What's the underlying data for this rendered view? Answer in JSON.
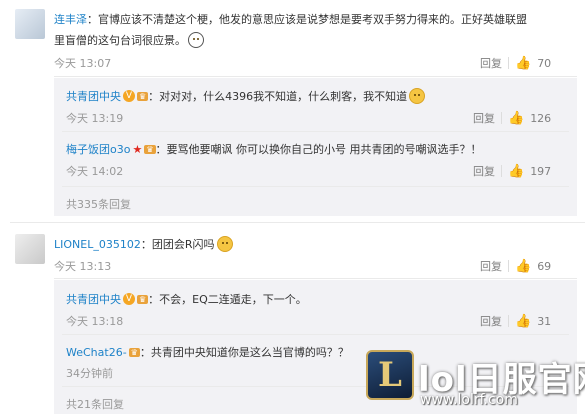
{
  "comments": [
    {
      "user": "连丰泽",
      "text_line1": "：官博应该不清楚这个梗，他发的意思应该是说梦想是要考双手努力得来的。正好英雄联盟",
      "text_line2": "里盲僧的这句台词很应景。",
      "emoji": "dog-emoji",
      "time": "今天 13:07",
      "reply_label": "回复",
      "likes": "70",
      "replies": [
        {
          "user": "共青团中央",
          "text": "：对对对，什么4396我不知道，什么刺客，我不知道",
          "emoji": "smile-emoji",
          "time": "今天 13:19",
          "reply_label": "回复",
          "likes": "126"
        },
        {
          "user": "梅子饭团o3o",
          "text": "：要骂他要嘲讽 你可以换你自己的小号 用共青团的号嘲讽选手？！",
          "time": "今天 14:02",
          "reply_label": "回复",
          "likes": "197"
        }
      ],
      "more_replies": "共335条回复"
    },
    {
      "user": "LIONEL_035102",
      "text": "：团团会R闪吗",
      "emoji": "smile-emoji",
      "time": "今天 13:13",
      "reply_label": "回复",
      "likes": "69",
      "replies": [
        {
          "user": "共青团中央",
          "text": "：不会，EQ二连遁走，下一个。",
          "time": "今天 13:18",
          "reply_label": "回复",
          "likes": "31"
        },
        {
          "user": "WeChat26-",
          "text": "：共青团中央知道你是这么当官博的吗？？",
          "time": "34分钟前"
        }
      ],
      "more_replies": "共21条回复"
    }
  ],
  "watermark": {
    "logo_letter": "L",
    "title": "lol日服官网",
    "url": "www.lolrf.com"
  },
  "colors": {
    "name": "#eb7350",
    "link": "#1e82c8",
    "muted": "#999999",
    "sub_bg": "#f2f2f5"
  }
}
